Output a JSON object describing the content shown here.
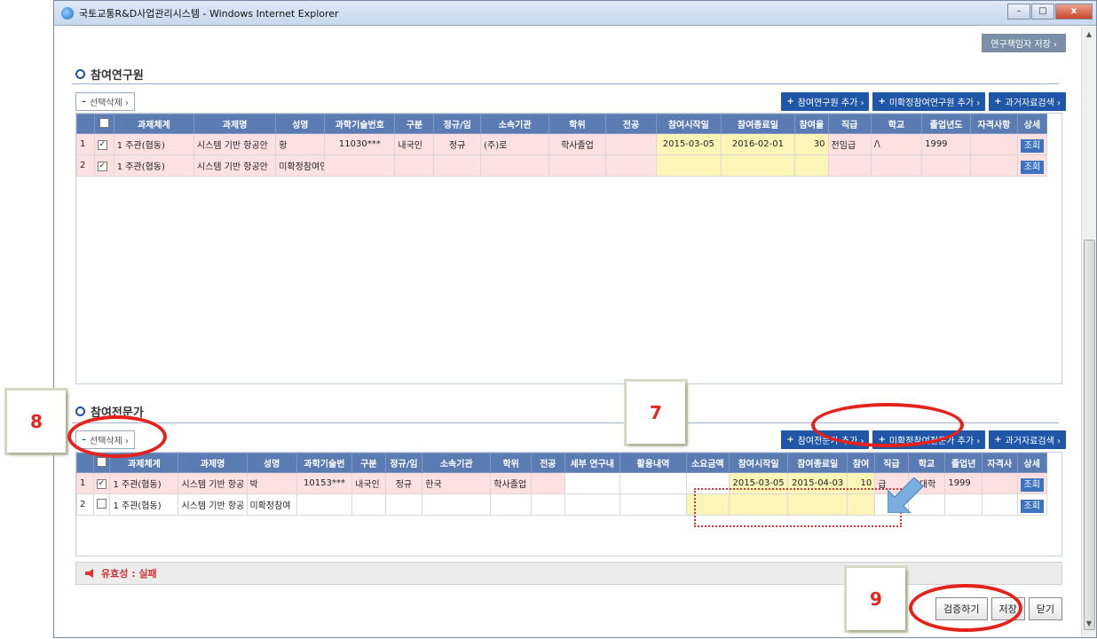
{
  "window": {
    "title": "국토교통R&D사업관리시스템 - Windows Internet Explorer",
    "controls": [
      "–",
      "□",
      "x"
    ]
  },
  "header": {
    "save_researcher_label": "연구책임자 저장 ›"
  },
  "section1": {
    "title": "참여연구원",
    "delete_label": "선택삭제 ›",
    "buttons": [
      "참여연구원 추가 ›",
      "미확정참여연구원 추가 ›",
      "과거자료검색 ›"
    ],
    "columns": [
      "",
      "",
      "과제체계",
      "과제명",
      "성명",
      "과학기술번호",
      "구분",
      "정규/임",
      "소속기관",
      "학위",
      "전공",
      "참여시작일",
      "참여종료일",
      "참여율",
      "직급",
      "학교",
      "졸업년도",
      "자격사항",
      "상세"
    ],
    "rows": [
      {
        "no": "1",
        "checked": true,
        "system": "1 주관(협동)",
        "title": "시스템 기반 항공안",
        "name": "황",
        "sci_no": "11030***",
        "type": "내국인",
        "regular": "정규",
        "org": "(주)로",
        "degree": "학사졸업",
        "major": "",
        "start": "2015-03-05",
        "end": "2016-02-01",
        "rate": "30",
        "rank": "전임급",
        "school": "  /\\           ",
        "grad_year": "1999",
        "cert": "",
        "detail": "조회"
      },
      {
        "no": "2",
        "checked": true,
        "system": "1 주관(협동)",
        "title": "시스템 기반 항공안",
        "name": "미확정참여연",
        "sci_no": "",
        "type": "",
        "regular": "",
        "org": "",
        "degree": "",
        "major": "",
        "start": "",
        "end": "",
        "rate": "",
        "rank": "",
        "school": "",
        "grad_year": "",
        "cert": "",
        "detail": "조회"
      }
    ]
  },
  "section2": {
    "title": "참여전문가",
    "delete_label": "선택삭제 ›",
    "buttons": [
      "참여전문가 추가 ›",
      "미확정참여전문가 추가 ›",
      "과거자료검색 ›"
    ],
    "columns": [
      "",
      "",
      "과제체계",
      "과제명",
      "성명",
      "과학기술번",
      "구분",
      "정규/임",
      "소속기관",
      "학위",
      "전공",
      "세부 연구내",
      "활용내역",
      "소요금액",
      "참여시작일",
      "참여종료일",
      "참여",
      "직급",
      "학교",
      "졸업년",
      "자격사",
      "상세"
    ],
    "rows": [
      {
        "no": "1",
        "checked": true,
        "system": "1 주관(협동)",
        "title": "시스템 기반 항공",
        "name": "박",
        "sci_no": "10153***",
        "type": "내국인",
        "regular": "정규",
        "org": "한국",
        "degree": "학사졸업",
        "major": "",
        "detail_research": "",
        "usage": "",
        "amount": "",
        "start": "2015-03-05",
        "end": "2015-04-03",
        "rate": "10",
        "rank": "급",
        "school": "  출대학",
        "grad_year": "1999",
        "cert": "",
        "detail": "조회"
      },
      {
        "no": "2",
        "checked": false,
        "system": "1 주관(협동)",
        "title": "시스템 기반 항공",
        "name": "미확정참여",
        "sci_no": "",
        "type": "",
        "regular": "",
        "org": "",
        "degree": "",
        "major": "",
        "detail_research": "",
        "usage": "",
        "amount": "",
        "start": "",
        "end": "",
        "rate": "",
        "rank": "",
        "school": "",
        "grad_year": "",
        "cert": "",
        "detail": "조회"
      }
    ]
  },
  "validity": {
    "text": "유효성 : 실패"
  },
  "footer": {
    "verify_label": "검증하기",
    "save_label": "저장",
    "close_label": "닫기"
  },
  "callouts": {
    "c7": "7",
    "c8": "8",
    "c9": "9"
  },
  "colors": {
    "accent_blue": "#1f56a8",
    "header_blue": "#5a7cb3",
    "highlight_red": "#e5211b",
    "row_pink": "#fde1e1",
    "row_yellow": "#fcf5b8"
  }
}
